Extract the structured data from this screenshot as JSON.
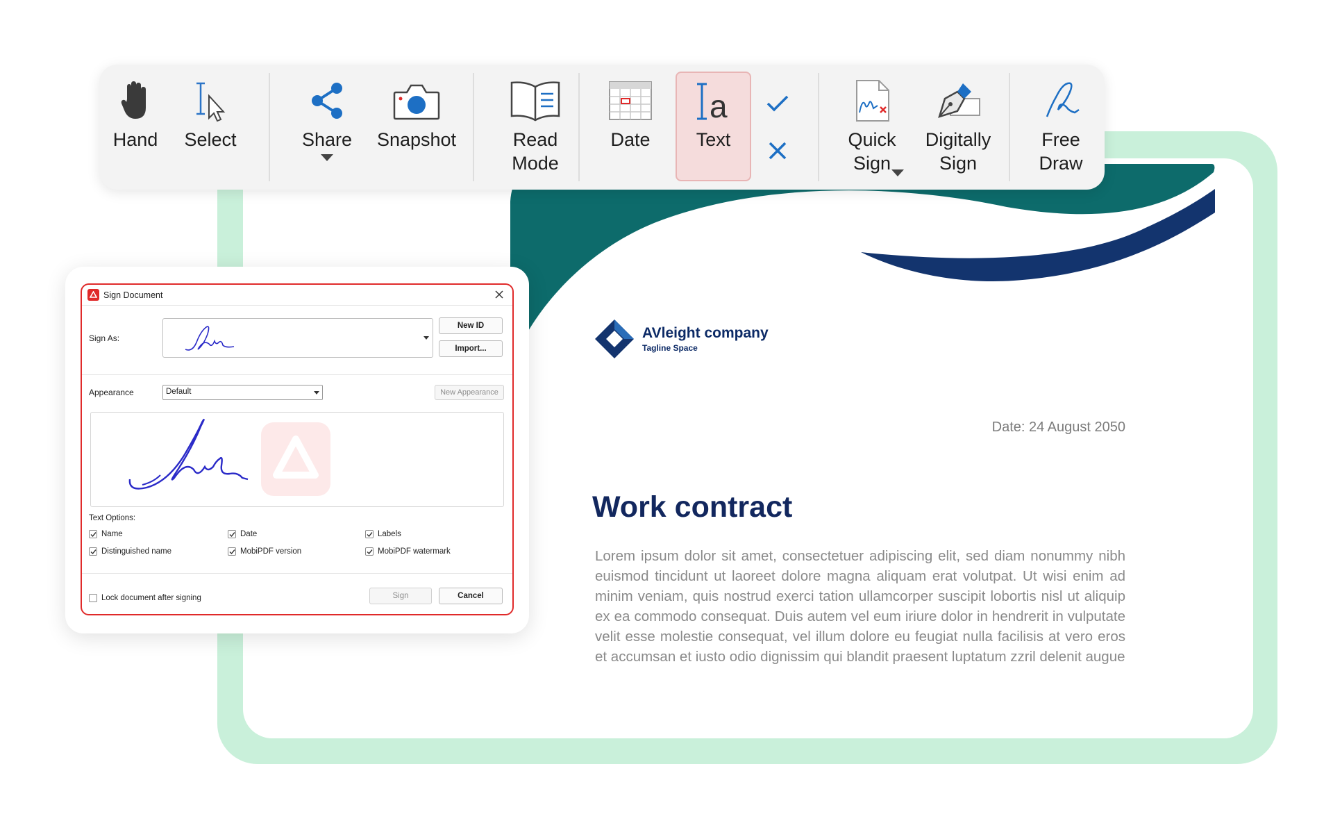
{
  "toolbar": {
    "items": [
      {
        "label": "Hand",
        "icon": "hand-icon"
      },
      {
        "label": "Select",
        "icon": "select-cursor-icon"
      },
      {
        "label": "Share",
        "icon": "share-icon"
      },
      {
        "label": "Snapshot",
        "icon": "camera-icon"
      },
      {
        "label": "Read\nMode",
        "icon": "book-icon"
      },
      {
        "label": "Date",
        "icon": "calendar-icon"
      },
      {
        "label": "Text",
        "icon": "text-tool-icon"
      },
      {
        "label": "Quick\nSign",
        "icon": "quick-sign-icon"
      },
      {
        "label": "Digitally\nSign",
        "icon": "digital-sign-icon"
      },
      {
        "label": "Free\nDraw",
        "icon": "free-draw-icon"
      }
    ],
    "active_item": "Text",
    "accent": "#1d6fc4"
  },
  "dialog": {
    "title": "Sign Document",
    "sign_as_label": "Sign As:",
    "new_id_button": "New ID",
    "import_button": "Import...",
    "appearance_label": "Appearance",
    "appearance_value": "Default",
    "new_appearance_button": "New Appearance",
    "text_options_label": "Text Options:",
    "options": [
      {
        "label": "Name",
        "checked": true
      },
      {
        "label": "Date",
        "checked": true
      },
      {
        "label": "Labels",
        "checked": true
      },
      {
        "label": "Distinguished name",
        "checked": true
      },
      {
        "label": "MobiPDF version",
        "checked": true
      },
      {
        "label": "MobiPDF watermark",
        "checked": true
      }
    ],
    "lock_label": "Lock document after signing",
    "lock_checked": false,
    "sign_button": "Sign",
    "cancel_button": "Cancel",
    "accent": "#e02a2a"
  },
  "document": {
    "company_name": "AVleight company",
    "tagline": "Tagline Space",
    "date": "Date: 24 August 2050",
    "title": "Work contract",
    "body": "Lorem ipsum dolor sit amet, consectetuer adipiscing elit, sed diam nonummy nibh euismod tincidunt ut laoreet dolore magna aliquam erat volutpat. Ut wisi enim ad minim veniam, quis nostrud exerci tation ullamcorper suscipit lobortis nisl ut aliquip ex ea commodo consequat. Duis autem vel eum iriure dolor in hendrerit in vulputate velit esse molestie consequat, vel illum dolore eu feugiat nulla facilisis at vero eros et accumsan et iusto odio dignissim qui blandit praesent luptatum zzril delenit augue",
    "header_colors": {
      "teal": "#0d6b6b",
      "navy": "#13346e"
    }
  }
}
